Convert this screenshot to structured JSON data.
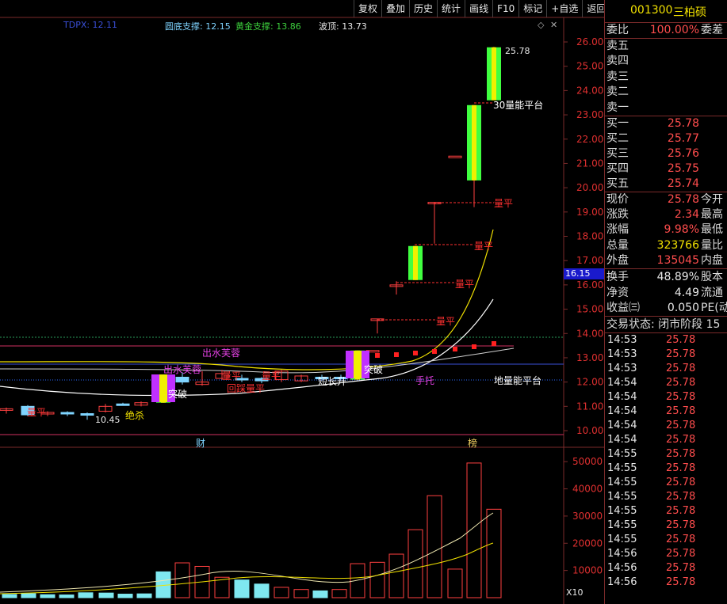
{
  "toolbar": [
    "复权",
    "叠加",
    "历史",
    "统计",
    "画线",
    "F10",
    "标记",
    "+自选",
    "返回"
  ],
  "indicators": {
    "tdpx": "TDPX: 12.11",
    "bottom_support": "圆底支撑: 12.15",
    "gold_support": "黄金支撑: 13.86",
    "wave_top": "波顶: 13.73"
  },
  "price_axis": [
    "26.00",
    "25.00",
    "24.00",
    "23.00",
    "22.00",
    "21.00",
    "20.00",
    "19.00",
    "18.00",
    "17.00",
    "16.00",
    "15.00",
    "14.00",
    "13.00",
    "12.00",
    "11.00",
    "10.00"
  ],
  "current_price_tag": "16.15",
  "volume_axis": [
    "50000",
    "40000",
    "30000",
    "20000",
    "10000"
  ],
  "volume_unit": "X10",
  "event_labels": {
    "cai": "财",
    "bang": "榜"
  },
  "annotations": {
    "high": "25.78",
    "low": "10.45",
    "liangping": "量平",
    "chushui": "出水芙蓉",
    "tupo": "突破",
    "jueshao": "绝杀",
    "duanchang": "短长升",
    "shoutuo": "手托",
    "pingtai": "地量能平台",
    "pingtai_top": "30量能平台",
    "huiju": "回踩量平"
  },
  "chart_data": {
    "type": "candlestick",
    "candles": [
      {
        "o": 10.85,
        "h": 10.95,
        "l": 10.7,
        "c": 10.9,
        "up": true
      },
      {
        "o": 11.0,
        "h": 11.05,
        "l": 10.6,
        "c": 10.65,
        "up": false
      },
      {
        "o": 10.7,
        "h": 10.8,
        "l": 10.6,
        "c": 10.75,
        "up": true
      },
      {
        "o": 10.75,
        "h": 10.8,
        "l": 10.6,
        "c": 10.7,
        "up": false
      },
      {
        "o": 10.7,
        "h": 10.75,
        "l": 10.45,
        "c": 10.7,
        "up": false
      },
      {
        "o": 10.8,
        "h": 11.1,
        "l": 10.75,
        "c": 11.0,
        "up": true
      },
      {
        "o": 11.1,
        "h": 11.15,
        "l": 11.05,
        "c": 11.1,
        "up": false
      },
      {
        "o": 11.05,
        "h": 11.2,
        "l": 11.0,
        "c": 11.15,
        "up": true
      },
      {
        "o": 11.15,
        "h": 12.3,
        "l": 11.15,
        "c": 12.25,
        "up": true
      },
      {
        "o": 12.2,
        "h": 12.4,
        "l": 11.9,
        "c": 12.0,
        "up": false
      },
      {
        "o": 12.0,
        "h": 12.45,
        "l": 11.85,
        "c": 11.9,
        "up": true
      },
      {
        "o": 12.35,
        "h": 12.5,
        "l": 12.1,
        "c": 12.15,
        "up": true
      },
      {
        "o": 12.15,
        "h": 12.3,
        "l": 12.0,
        "c": 12.1,
        "up": false
      },
      {
        "o": 12.05,
        "h": 12.2,
        "l": 11.95,
        "c": 12.15,
        "up": false
      },
      {
        "o": 12.1,
        "h": 12.5,
        "l": 12.0,
        "c": 12.45,
        "up": true
      },
      {
        "o": 12.05,
        "h": 12.3,
        "l": 12.0,
        "c": 12.25,
        "up": true
      },
      {
        "o": 12.2,
        "h": 12.3,
        "l": 12.1,
        "c": 12.2,
        "up": false
      },
      {
        "o": 12.2,
        "h": 12.3,
        "l": 12.1,
        "c": 12.15,
        "up": false
      },
      {
        "o": 12.1,
        "h": 13.3,
        "l": 12.1,
        "c": 13.3,
        "up": true
      },
      {
        "o": 13.3,
        "h": 13.3,
        "l": 13.3,
        "c": 13.3,
        "up": true
      },
      {
        "o": 14.6,
        "h": 14.6,
        "l": 14.0,
        "c": 14.6,
        "up": true
      },
      {
        "o": 16.0,
        "h": 16.15,
        "l": 15.6,
        "c": 16.0,
        "up": true
      },
      {
        "o": 16.2,
        "h": 17.6,
        "l": 16.2,
        "c": 17.6,
        "up": true
      },
      {
        "o": 19.4,
        "h": 19.4,
        "l": 17.7,
        "c": 19.4,
        "up": true
      },
      {
        "o": 21.3,
        "h": 21.3,
        "l": 21.3,
        "c": 21.3,
        "up": true
      },
      {
        "o": 20.3,
        "h": 23.4,
        "l": 19.2,
        "c": 23.4,
        "up": true
      },
      {
        "o": 23.6,
        "h": 25.8,
        "l": 23.6,
        "c": 25.78,
        "up": true
      }
    ],
    "volumes": [
      1.2,
      1.5,
      1.1,
      1.0,
      1.8,
      1.7,
      1.3,
      1.4,
      9.5,
      12.8,
      11.5,
      7.5,
      6.5,
      5.0,
      3.8,
      3.0,
      2.5,
      3.0,
      12.5,
      13.0,
      16.0,
      25.0,
      37.5,
      10.5,
      49.5,
      32.5
    ],
    "ylim": [
      10,
      26.5
    ],
    "vol_ylim": [
      0,
      55000
    ]
  },
  "panel": {
    "code": "001300",
    "name": "三柏硕",
    "weibi_label": "委比",
    "weibi_value": "100.00%",
    "weicha_label": "委差",
    "asks": [
      {
        "label": "卖五",
        "price": "",
        "vol": ""
      },
      {
        "label": "卖四",
        "price": "",
        "vol": ""
      },
      {
        "label": "卖三",
        "price": "",
        "vol": ""
      },
      {
        "label": "卖二",
        "price": "",
        "vol": ""
      },
      {
        "label": "卖一",
        "price": "",
        "vol": ""
      }
    ],
    "bids": [
      {
        "label": "买一",
        "price": "25.78"
      },
      {
        "label": "买二",
        "price": "25.77"
      },
      {
        "label": "买三",
        "price": "25.76"
      },
      {
        "label": "买四",
        "price": "25.75"
      },
      {
        "label": "买五",
        "price": "25.74"
      }
    ],
    "stats": [
      {
        "label": "现价",
        "value": "25.78",
        "label2": "今开",
        "color": "red"
      },
      {
        "label": "涨跌",
        "value": "2.34",
        "label2": "最高",
        "color": "red"
      },
      {
        "label": "涨幅",
        "value": "9.98%",
        "label2": "最低",
        "color": "red"
      },
      {
        "label": "总量",
        "value": "323766",
        "label2": "量比",
        "color": "yellow"
      },
      {
        "label": "外盘",
        "value": "135045",
        "label2": "内盘",
        "color": "red"
      }
    ],
    "stats2": [
      {
        "label": "换手",
        "value": "48.89%",
        "label2": "股本"
      },
      {
        "label": "净资",
        "value": "4.49",
        "label2": "流通"
      },
      {
        "label": "收益㈢",
        "value": "0.050",
        "label2": "PE(动"
      }
    ],
    "trade_status": "交易状态: 闭市阶段 15",
    "ticks": [
      {
        "time": "14:53",
        "price": "25.78"
      },
      {
        "time": "14:53",
        "price": "25.78"
      },
      {
        "time": "14:53",
        "price": "25.78"
      },
      {
        "time": "14:54",
        "price": "25.78"
      },
      {
        "time": "14:54",
        "price": "25.78"
      },
      {
        "time": "14:54",
        "price": "25.78"
      },
      {
        "time": "14:54",
        "price": "25.78"
      },
      {
        "time": "14:54",
        "price": "25.78"
      },
      {
        "time": "14:55",
        "price": "25.78"
      },
      {
        "time": "14:55",
        "price": "25.78"
      },
      {
        "time": "14:55",
        "price": "25.78"
      },
      {
        "time": "14:55",
        "price": "25.78"
      },
      {
        "time": "14:55",
        "price": "25.78"
      },
      {
        "time": "14:55",
        "price": "25.78"
      },
      {
        "time": "14:55",
        "price": "25.78"
      },
      {
        "time": "14:56",
        "price": "25.78"
      },
      {
        "time": "14:56",
        "price": "25.78"
      },
      {
        "time": "14:56",
        "price": "25.78"
      }
    ]
  }
}
